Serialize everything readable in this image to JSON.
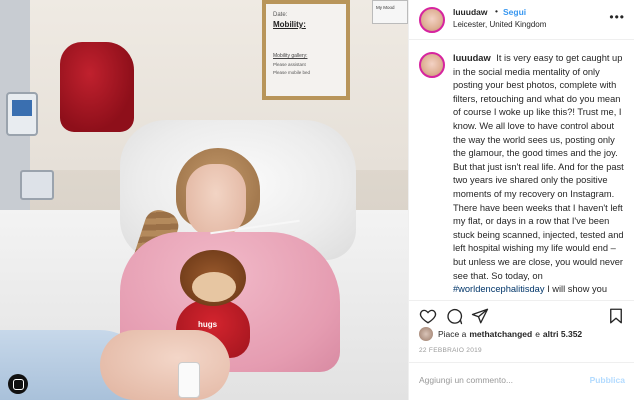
{
  "header": {
    "username": "luuudaw",
    "separator": "•",
    "follow_label": "Segui",
    "location": "Leicester, United Kingdom",
    "more_icon": "more-horizontal-icon"
  },
  "photo": {
    "board_line1": "Date:",
    "board_title": "Mobility:",
    "board_sub": "Mobility gallery:",
    "board_item1": "Please assistant",
    "board_item2": "Please mobile bed",
    "sign_text": "My Mood",
    "toy_label": "hugs",
    "corner_icon": "instagram-icon"
  },
  "caption": {
    "username": "luuudaw",
    "text_before": "It is very easy to get caught up in the social media mentality of only posting your best photos, complete with filters, retouching and what do you mean of course I woke up like this?! Trust me, I know. We all love to have control about the way the world sees us, posting only the glamour, the good times and the joy. But that just isn't real life. And for the past two years ive shared only the positive moments of my recovery on Instagram. There have been weeks that I haven't left my flat, or days in a row that I've been stuck being scanned, injected, tested and left hospital wishing my life would end –but unless we are close, you would never see that. So today, on ",
    "hashtag": "#worldencephalitisday",
    "text_after": " I will show you what it is to have no control over your"
  },
  "actions": {
    "like_icon": "heart-icon",
    "comment_icon": "comment-icon",
    "share_icon": "share-icon",
    "save_icon": "bookmark-icon"
  },
  "likes": {
    "prefix": "Piace a",
    "liker": "methatchanged",
    "conjunction": "e",
    "others": "altri 5.352"
  },
  "date": "22 FEBBRAIO 2019",
  "comment_box": {
    "placeholder": "Aggiungi un commento...",
    "publish_label": "Pubblica"
  },
  "colors": {
    "link_blue": "#3897f0",
    "publish_disabled": "#b3dbff",
    "text_dark": "#262626",
    "muted": "#999999"
  }
}
